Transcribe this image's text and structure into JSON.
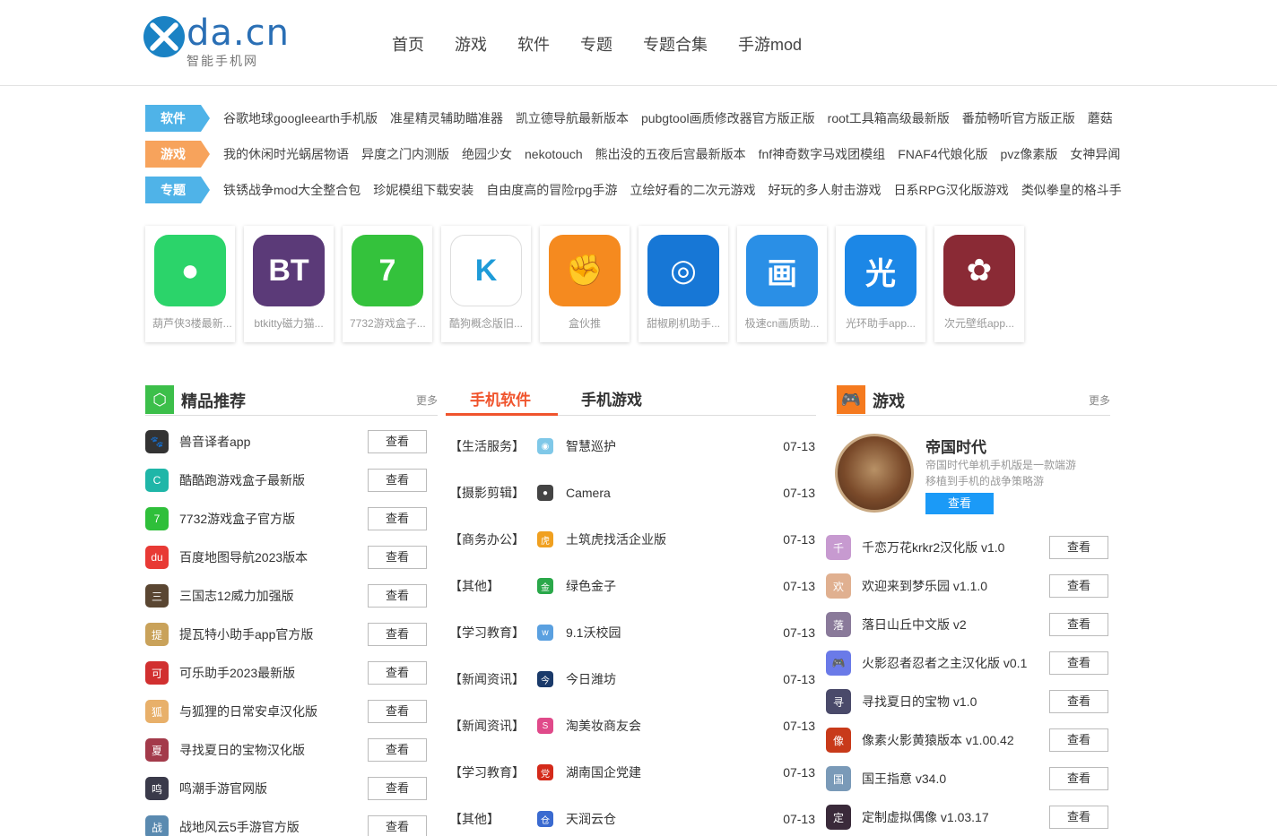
{
  "header": {
    "logo_text": "da.cn",
    "logo_sub": "智能手机网",
    "nav": [
      "首页",
      "游戏",
      "软件",
      "专题",
      "专题合集",
      "手游mod"
    ]
  },
  "tag_rows": [
    {
      "tag": "软件",
      "color": "#4fb3e8",
      "links": [
        "谷歌地球googleearth手机版",
        "准星精灵辅助瞄准器",
        "凯立德导航最新版本",
        "pubgtool画质修改器官方版正版",
        "root工具箱高级最新版",
        "番茄畅听官方版正版",
        "蘑菇"
      ]
    },
    {
      "tag": "游戏",
      "color": "#f7a35c",
      "links": [
        "我的休闲时光蜗居物语",
        "异度之门内测版",
        "绝园少女",
        "nekotouch",
        "熊出没的五夜后宫最新版本",
        "fnf神奇数字马戏团模组",
        "FNAF4代娘化版",
        "pvz像素版",
        "女神异闻"
      ]
    },
    {
      "tag": "专题",
      "color": "#4fb3e8",
      "links": [
        "铁锈战争mod大全整合包",
        "珍妮模组下载安装",
        "自由度高的冒险rpg手游",
        "立绘好看的二次元游戏",
        "好玩的多人射击游戏",
        "日系RPG汉化版游戏",
        "类似拳皇的格斗手"
      ]
    }
  ],
  "apps": [
    {
      "name": "葫芦侠3楼最新...",
      "icon": "gourd-icon",
      "bg": "#2bd46a",
      "glyph": "●"
    },
    {
      "name": "btkitty磁力猫...",
      "icon": "cat-icon",
      "bg": "#5b3a78",
      "glyph": "BT"
    },
    {
      "name": "7732游戏盒子...",
      "icon": "seven-icon",
      "bg": "#34c23c",
      "glyph": "7"
    },
    {
      "name": "酷狗概念版旧...",
      "icon": "kugou-icon",
      "bg": "#ffffff",
      "glyph": "K"
    },
    {
      "name": "盒伙推",
      "icon": "fist-icon",
      "bg": "#f58a1f",
      "glyph": "✊"
    },
    {
      "name": "甜椒刷机助手...",
      "icon": "pepper-icon",
      "bg": "#1777d6",
      "glyph": "◎"
    },
    {
      "name": "极速cn画质助...",
      "icon": "quality-icon",
      "bg": "#2a8fe6",
      "glyph": "画"
    },
    {
      "name": "光环助手app...",
      "icon": "halo-icon",
      "bg": "#1c87e6",
      "glyph": "光"
    },
    {
      "name": "次元壁纸app...",
      "icon": "wallpaper-icon",
      "bg": "#8a2a35",
      "glyph": "✿"
    }
  ],
  "recommend": {
    "title": "精品推荐",
    "more": "更多",
    "button": "查看",
    "items": [
      {
        "title": "兽音译者app",
        "bg": "#333333",
        "glyph": "🐾"
      },
      {
        "title": "酷酷跑游戏盒子最新版",
        "bg": "#1fb6a8",
        "glyph": "C"
      },
      {
        "title": "7732游戏盒子官方版",
        "bg": "#2fbf3a",
        "glyph": "7"
      },
      {
        "title": "百度地图导航2023版本",
        "bg": "#e83a35",
        "glyph": "du"
      },
      {
        "title": "三国志12威力加强版",
        "bg": "#5a4632",
        "glyph": "三"
      },
      {
        "title": "提瓦特小助手app官方版",
        "bg": "#c9a25a",
        "glyph": "提"
      },
      {
        "title": "可乐助手2023最新版",
        "bg": "#d13030",
        "glyph": "可"
      },
      {
        "title": "与狐狸的日常安卓汉化版",
        "bg": "#e8b06a",
        "glyph": "狐"
      },
      {
        "title": "寻找夏日的宝物汉化版",
        "bg": "#a33a4a",
        "glyph": "夏"
      },
      {
        "title": "鸣潮手游官网版",
        "bg": "#3a3a4a",
        "glyph": "鸣"
      },
      {
        "title": "战地风云5手游官方版",
        "bg": "#5a8ab0",
        "glyph": "战"
      }
    ]
  },
  "software": {
    "tabs": [
      "手机软件",
      "手机游戏"
    ],
    "items": [
      {
        "cat": "【生活服务】",
        "name": "智慧巡护",
        "date": "07-13",
        "bg": "#7fc8e8",
        "glyph": "◉"
      },
      {
        "cat": "【摄影剪辑】",
        "name": "Camera",
        "date": "07-13",
        "bg": "#444444",
        "glyph": "●"
      },
      {
        "cat": "【商务办公】",
        "name": "土筑虎找活企业版",
        "date": "07-13",
        "bg": "#f0a020",
        "glyph": "虎"
      },
      {
        "cat": "【其他】",
        "name": "绿色金子",
        "date": "07-13",
        "bg": "#2aa84a",
        "glyph": "金"
      },
      {
        "cat": "【学习教育】",
        "name": "9.1沃校园",
        "date": "07-13",
        "bg": "#5aa0e0",
        "glyph": "w"
      },
      {
        "cat": "【新闻资讯】",
        "name": "今日潍坊",
        "date": "07-13",
        "bg": "#1a3a6a",
        "glyph": "今"
      },
      {
        "cat": "【新闻资讯】",
        "name": "淘美妆商友会",
        "date": "07-13",
        "bg": "#e04a8a",
        "glyph": "S"
      },
      {
        "cat": "【学习教育】",
        "name": "湖南国企党建",
        "date": "07-13",
        "bg": "#d42a1a",
        "glyph": "党"
      },
      {
        "cat": "【其他】",
        "name": "天润云仓",
        "date": "07-13",
        "bg": "#3a6ad0",
        "glyph": "仓"
      }
    ]
  },
  "games": {
    "title": "游戏",
    "more": "更多",
    "button": "查看",
    "featured": {
      "title": "帝国时代",
      "desc": "帝国时代单机手机版是一款端游移植到手机的战争策略游",
      "button": "查看"
    },
    "items": [
      {
        "title": "千恋万花krkr2汉化版 v1.0",
        "bg": "#c79ad0",
        "glyph": "千"
      },
      {
        "title": "欢迎来到梦乐园 v1.1.0",
        "bg": "#e0b090",
        "glyph": "欢"
      },
      {
        "title": "落日山丘中文版 v2",
        "bg": "#8a7a9a",
        "glyph": "落"
      },
      {
        "title": "火影忍者忍者之主汉化版 v0.1",
        "bg": "#6a7ae8",
        "glyph": "🎮"
      },
      {
        "title": "寻找夏日的宝物 v1.0",
        "bg": "#4a4a6a",
        "glyph": "寻"
      },
      {
        "title": "像素火影黄猿版本 v1.00.42",
        "bg": "#c83a1a",
        "glyph": "像"
      },
      {
        "title": "国王指意 v34.0",
        "bg": "#7a9ab8",
        "glyph": "国"
      },
      {
        "title": "定制虚拟偶像 v1.03.17",
        "bg": "#3a2a3a",
        "glyph": "定"
      }
    ]
  }
}
